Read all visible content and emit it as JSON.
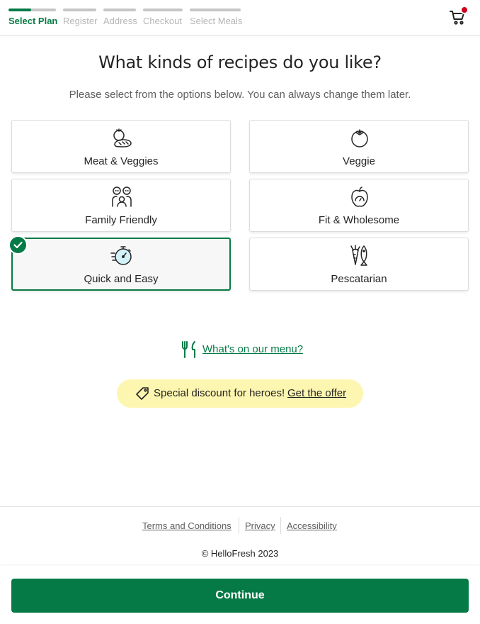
{
  "stepper": {
    "steps": [
      {
        "label": "Select Plan",
        "active": true,
        "progress": 0.48
      },
      {
        "label": "Register",
        "active": false,
        "progress": 0
      },
      {
        "label": "Address",
        "active": false,
        "progress": 0
      },
      {
        "label": "Checkout",
        "active": false,
        "progress": 0
      },
      {
        "label": "Select Meals",
        "active": false,
        "progress": 0
      }
    ]
  },
  "header": {
    "cart_icon": "cart-icon",
    "cart_badge_color": "#d0021b"
  },
  "page": {
    "title": "What kinds of recipes do you like?",
    "subtitle": "Please select from the options below. You can always change them later."
  },
  "preferences": [
    {
      "label": "Meat & Veggies",
      "icon": "meat-veggies-icon",
      "selected": false
    },
    {
      "label": "Veggie",
      "icon": "tomato-icon",
      "selected": false
    },
    {
      "label": "Family Friendly",
      "icon": "family-icon",
      "selected": false
    },
    {
      "label": "Fit & Wholesome",
      "icon": "apple-scale-icon",
      "selected": false
    },
    {
      "label": "Quick and Easy",
      "icon": "stopwatch-icon",
      "selected": true
    },
    {
      "label": "Pescatarian",
      "icon": "carrot-fish-icon",
      "selected": false
    }
  ],
  "menu_link": {
    "label": "What's on our menu?",
    "icon": "fork-knife-icon"
  },
  "discount": {
    "text": "Special discount for heroes!",
    "link": "Get the offer",
    "icon": "tag-icon"
  },
  "footer": {
    "links": [
      "Terms and Conditions",
      "Privacy",
      "Accessibility"
    ],
    "copyright": "© HelloFresh 2023"
  },
  "cta": {
    "label": "Continue"
  },
  "colors": {
    "brand_green": "#067a46",
    "highlight_yellow": "#fdf6b0",
    "selected_icon_fill": "#d3f1f9"
  }
}
